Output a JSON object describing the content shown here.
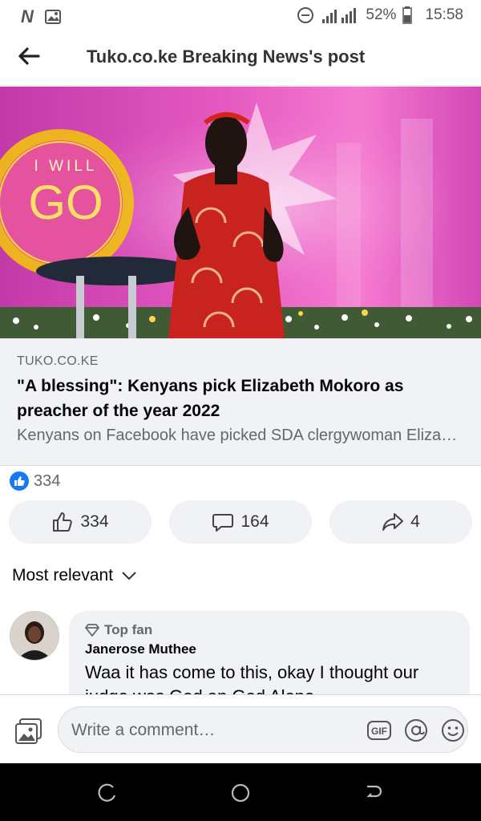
{
  "status_bar": {
    "network_type": "3G",
    "battery": "52%",
    "time": "15:58"
  },
  "header": {
    "title": "Tuko.co.ke Breaking News's post"
  },
  "hero": {
    "stage_text_line1": "I WILL",
    "stage_text_line2": "GO"
  },
  "link_preview": {
    "domain": "TUKO.CO.KE",
    "headline": "\"A blessing\": Kenyans pick Elizabeth Mokoro as preacher of the year 2022",
    "description": "Kenyans on Facebook have picked SDA clergywoman Elizabeth Mokoro as preacher of the year 2022"
  },
  "reactions": {
    "count": "334"
  },
  "actions": {
    "like_count": "334",
    "comment_count": "164",
    "share_count": "4"
  },
  "sort": {
    "label": "Most relevant"
  },
  "comment": {
    "badge": "Top fan",
    "author": "Janerose Muthee",
    "text": "Waa it has come to this, okay  I thought our judge was God an God Alone"
  },
  "composer": {
    "placeholder": "Write a comment…",
    "gif_label": "GIF"
  },
  "colors": {
    "facebook_blue": "#1877f2",
    "surface_gray": "#f0f2f5",
    "secondary_text": "#65676b"
  },
  "icons": [
    "n-app-icon",
    "gallery-notification-icon",
    "do-not-disturb-icon",
    "signal-icon",
    "battery-icon",
    "back-arrow-icon",
    "like-reaction-icon",
    "thumbs-up-icon",
    "comment-icon",
    "share-icon",
    "chevron-down-icon",
    "diamond-icon",
    "photo-icon",
    "gif-icon",
    "at-icon",
    "emoji-icon",
    "recent-apps-icon",
    "home-icon",
    "back-nav-icon"
  ]
}
